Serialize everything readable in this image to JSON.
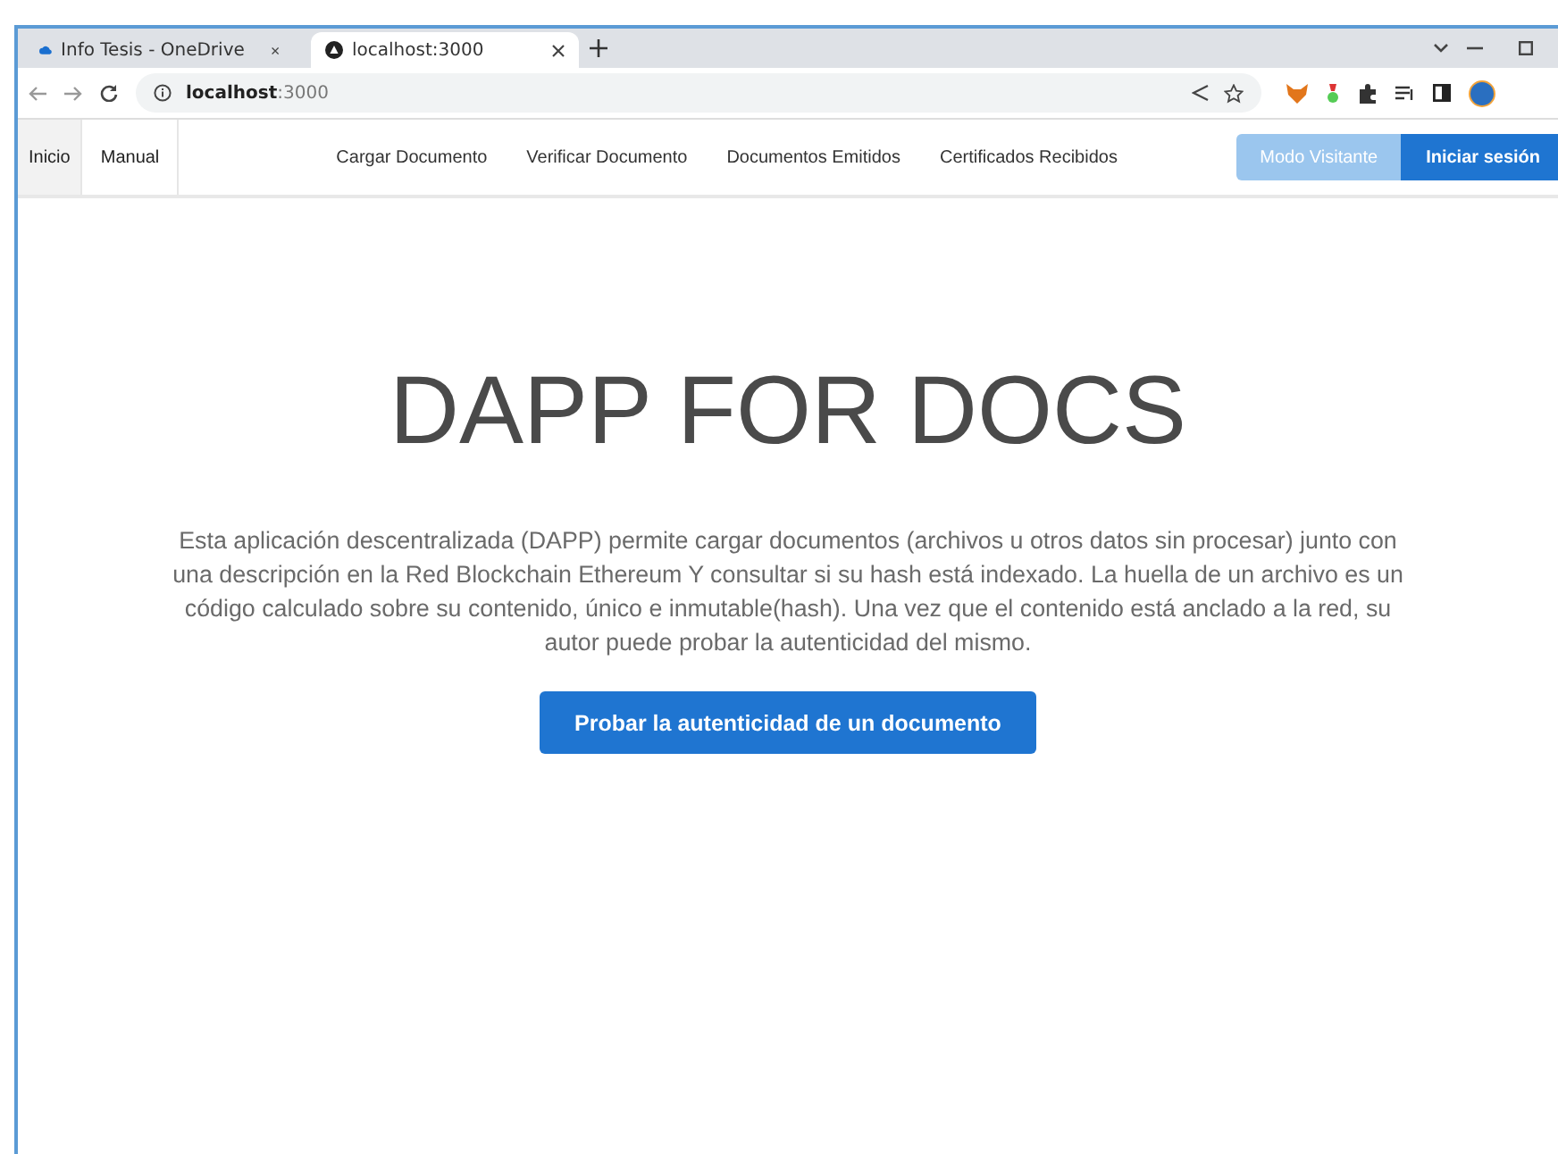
{
  "browser": {
    "tabs": [
      {
        "title": "Info Tesis - OneDrive",
        "selected": false
      },
      {
        "title": "localhost:3000",
        "selected": true
      }
    ],
    "address": "**localhost**:3000"
  },
  "nav": {
    "items": [
      {
        "label": "Inicio",
        "selected": true
      },
      {
        "label": "Manual",
        "selected": false
      }
    ],
    "links": [
      "Cargar Documento",
      "Verificar Documento",
      "Documentos Emitidos",
      "Certificados Recibidos"
    ],
    "buttons": [
      {
        "label": "Modo Visitante",
        "kind": "light"
      },
      {
        "label": "Iniciar sesión",
        "kind": "primary"
      }
    ]
  },
  "hero": {
    "title": "DAPP FOR DOCS",
    "text": "Esta aplicación descentralizada (DAPP) permite cargar documentos (archivos u otros datos sin procesar) junto con una descripción en la Red Blockchain Ethereum Y consultar si su hash está indexado. La huella de un archivo es un código calculado sobre su contenido, único e inmutable(hash). Una vez que el contenido está anclado a la red, su autor puede probar la autenticidad del mismo.",
    "button": "Probar la autenticidad de un documento"
  }
}
